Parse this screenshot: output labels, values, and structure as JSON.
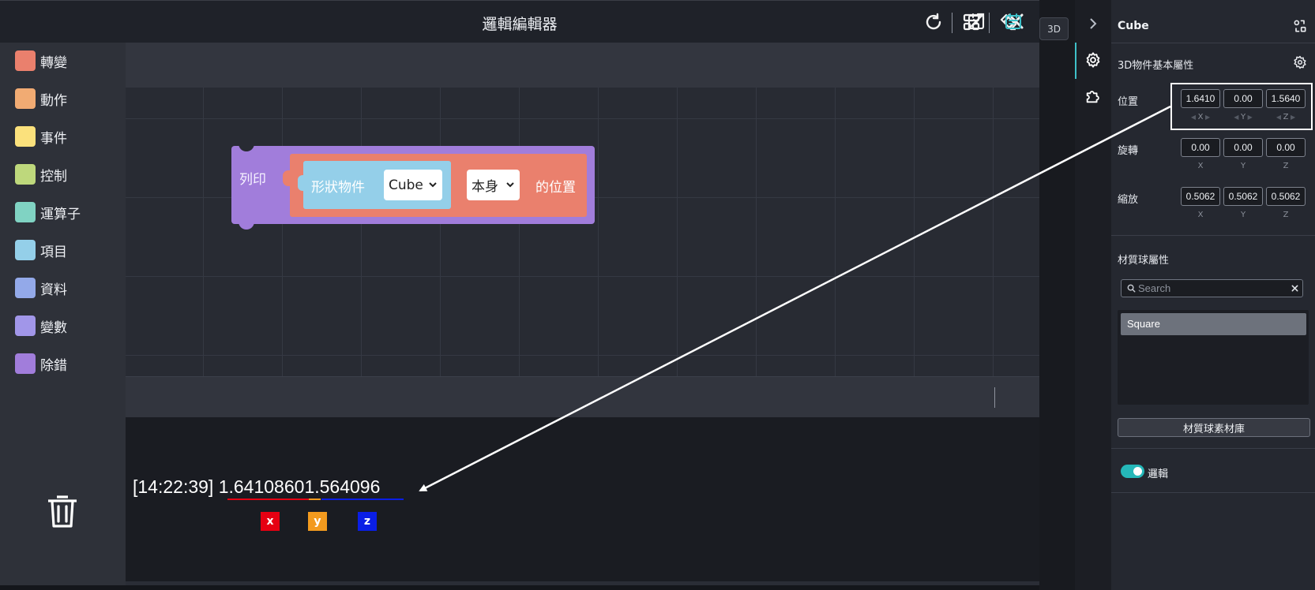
{
  "editor": {
    "title": "邏輯編輯器",
    "categories": [
      {
        "label": "轉變",
        "color": "#ea806d"
      },
      {
        "label": "動作",
        "color": "#f1ab73"
      },
      {
        "label": "事件",
        "color": "#fbe17c"
      },
      {
        "label": "控制",
        "color": "#bed87c"
      },
      {
        "label": "運算子",
        "color": "#80d3c3"
      },
      {
        "label": "項目",
        "color": "#94cfe9"
      },
      {
        "label": "資料",
        "color": "#93a9e9"
      },
      {
        "label": "變數",
        "color": "#a196e9"
      },
      {
        "label": "除錯",
        "color": "#a17ddb"
      }
    ],
    "blocks": {
      "print_label": "列印",
      "shape_label": "形狀物件",
      "object_value": "Cube",
      "self_value": "本身",
      "position_label": "的位置"
    },
    "console": {
      "time": "[14:22:39]",
      "x_value": "1.641086",
      "y_value": "0",
      "z_value": "1.564096",
      "tags": [
        "x",
        "y",
        "z"
      ]
    },
    "colors": {
      "x": "#e60012",
      "y": "#f39a1e",
      "z": "#0a1ee6"
    }
  },
  "scene": {
    "view_button": "3D"
  },
  "panel": {
    "object_name": "Cube",
    "basic_section": "3D物件基本屬性",
    "position": {
      "label": "位置",
      "values": [
        "1.6410",
        "0.00",
        "1.5640"
      ]
    },
    "rotation": {
      "label": "旋轉",
      "values": [
        "0.00",
        "0.00",
        "0.00"
      ]
    },
    "scale": {
      "label": "縮放",
      "values": [
        "0.5062",
        "0.5062",
        "0.5062"
      ]
    },
    "axes": [
      "X",
      "Y",
      "Z"
    ],
    "material_section": "材質球屬性",
    "search_placeholder": "Search",
    "materials": [
      "Square"
    ],
    "library_button": "材質球素材庫",
    "logic_toggle_label": "邏輯",
    "logic_toggle_on": true,
    "accent_color": "#25b8b9"
  }
}
